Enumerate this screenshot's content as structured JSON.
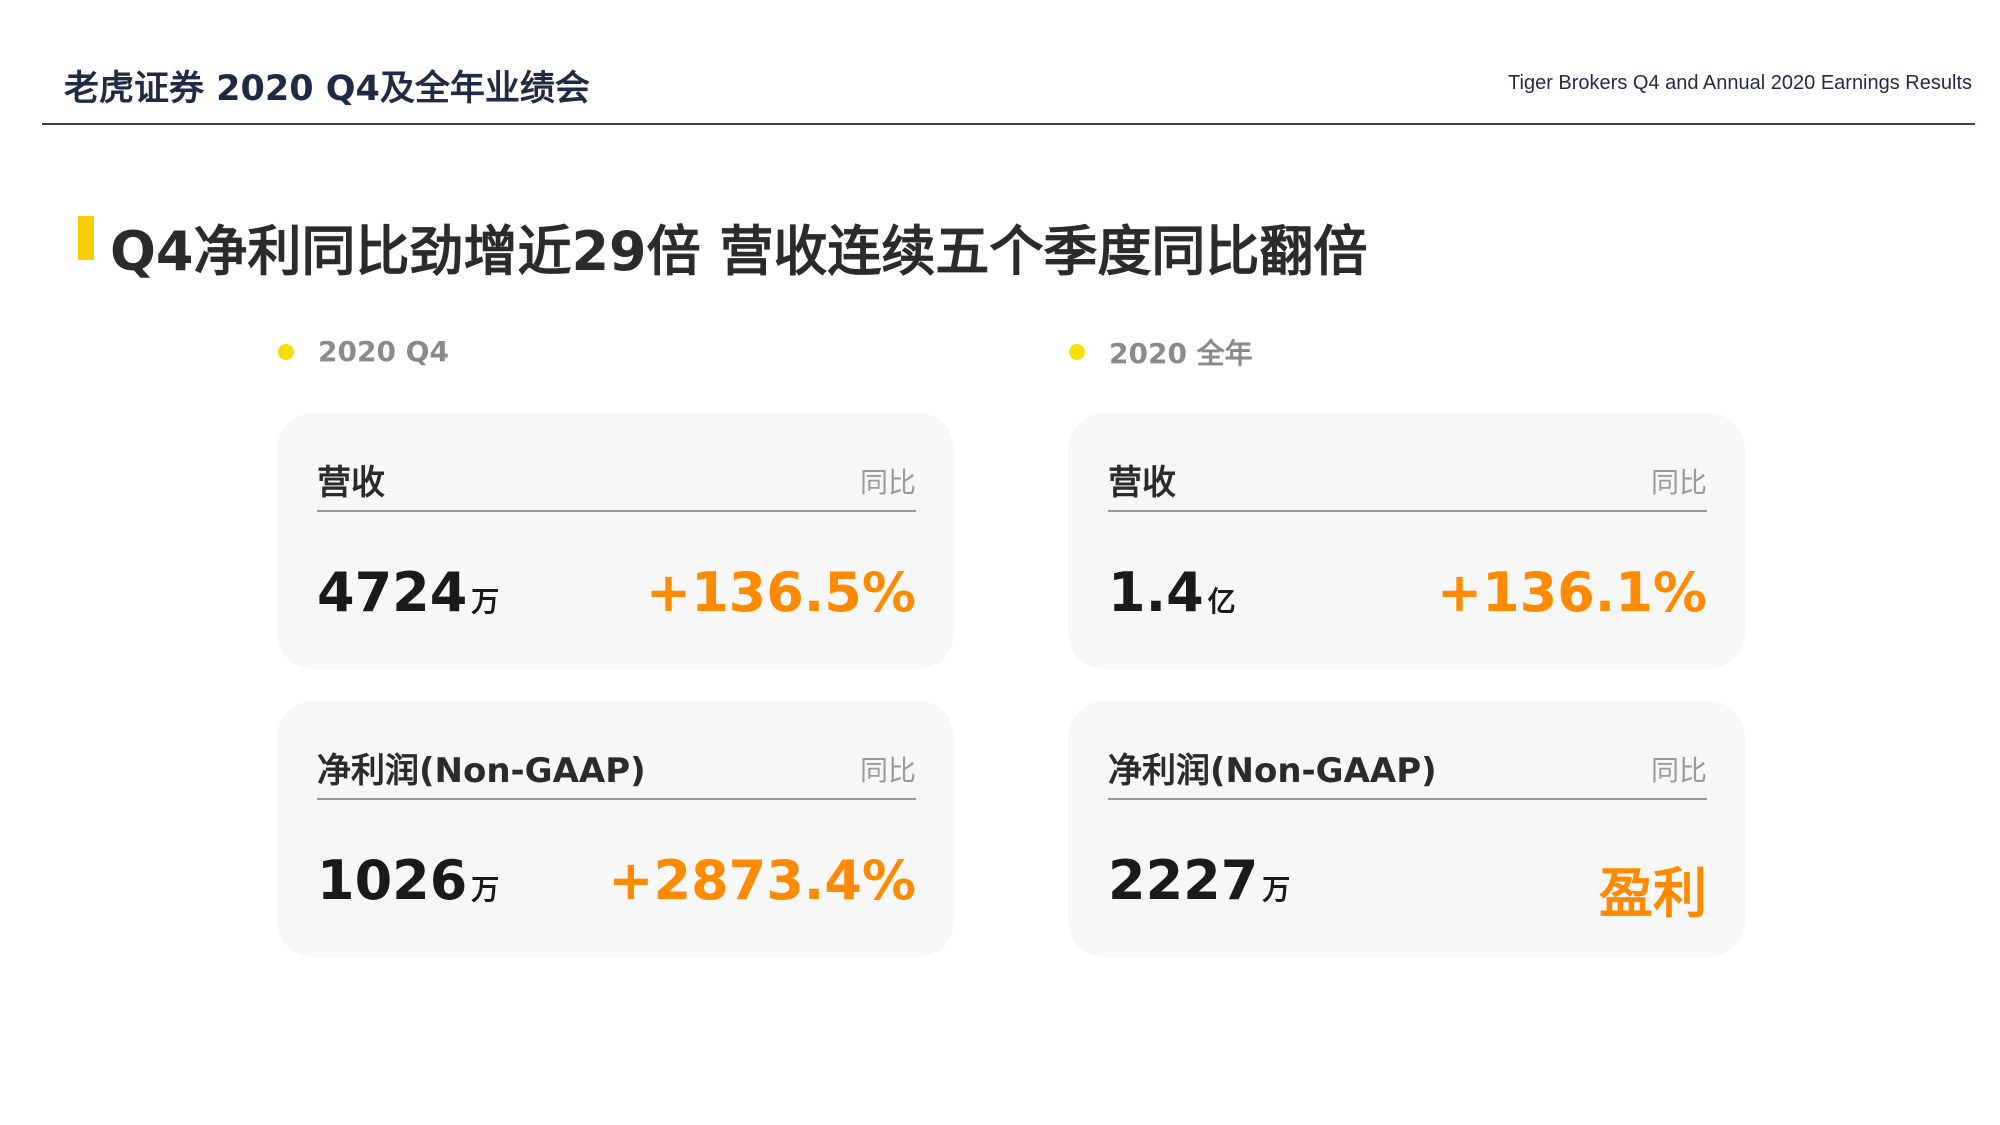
{
  "header": {
    "title": "老虎证券 2020 Q4及全年业绩会",
    "subtitle": "Tiger Brokers Q4 and Annual 2020 Earnings Results"
  },
  "headline": "Q4净利同比劲增近29倍 营收连续五个季度同比翻倍",
  "colors": {
    "accent_yellow": "#f6cd00",
    "positive_orange": "#ff8a00",
    "header_navy": "#1f2a44"
  },
  "sections": {
    "q4": {
      "label": "2020 Q4",
      "revenue": {
        "label": "营收",
        "yoy_label": "同比",
        "value": "4724",
        "unit": "万",
        "change": "+136.5%"
      },
      "net_income": {
        "label": "净利润(Non-GAAP)",
        "yoy_label": "同比",
        "value": "1026",
        "unit": "万",
        "change": "+2873.4%"
      }
    },
    "full_year": {
      "label": "2020 全年",
      "revenue": {
        "label": "营收",
        "yoy_label": "同比",
        "value": "1.4",
        "unit": "亿",
        "change": "+136.1%"
      },
      "net_income": {
        "label": "净利润(Non-GAAP)",
        "yoy_label": "同比",
        "value": "2227",
        "unit": "万",
        "change": "盈利"
      }
    }
  }
}
